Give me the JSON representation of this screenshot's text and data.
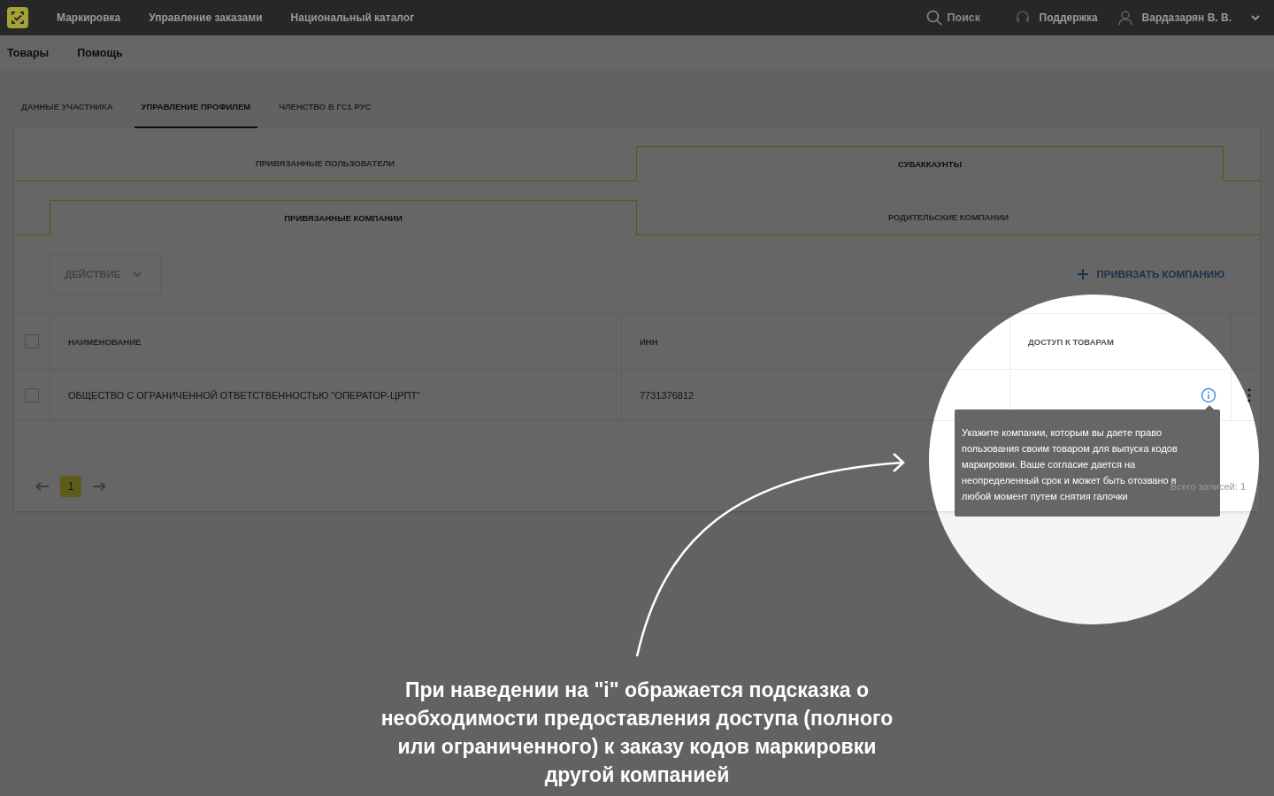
{
  "header": {
    "nav": [
      "Маркировка",
      "Управление заказами",
      "Национальный каталог"
    ],
    "search": {
      "placeholder": "Поиск"
    },
    "support": "Поддержка",
    "user": "Вардазарян В. В."
  },
  "subnav": [
    "Товары",
    "Помощь"
  ],
  "tabs": [
    {
      "label": "ДАННЫЕ УЧАСТНИКА",
      "selected": false
    },
    {
      "label": "УПРАВЛЕНИЕ ПРОФИЛЕМ",
      "selected": true
    },
    {
      "label": "ЧЛЕНСТВО В ГС1 РУС",
      "selected": false
    }
  ],
  "subtabs": [
    {
      "label": "ПРИВЯЗАННЫЕ ПОЛЬЗОВАТЕЛИ",
      "selected": false
    },
    {
      "label": "СУБАККАУНТЫ",
      "selected": true
    }
  ],
  "inner_tabs": [
    {
      "label": "ПРИВЯЗАННЫЕ КОМПАНИИ",
      "selected": true
    },
    {
      "label": "РОДИТЕЛЬСКИЕ КОМПАНИИ",
      "selected": false
    }
  ],
  "toolbar": {
    "action": "ДЕЙСТВИЕ",
    "add": "ПРИВЯЗАТЬ КОМПАНИЮ"
  },
  "table": {
    "all_checked": false,
    "columns": [
      "НАИМЕНОВАНИЕ",
      "ИНН",
      "ДОСТУП К ТОВАРАМ"
    ],
    "rows": [
      {
        "checked": false,
        "name": "ОБЩЕСТВО С ОГРАНИЧЕННОЙ ОТВЕТСТВЕННОСТЬЮ \"ОПЕРАТОР-ЦРПТ\"",
        "inn": "7731376812"
      }
    ]
  },
  "pagination": {
    "pages": [
      {
        "label": "1",
        "selected": true
      }
    ],
    "total": "Всего записей: 1"
  },
  "tooltip": "Укажите компании, которым вы даете право пользования своим товаром для выпуска кодов маркировки. Ваше согласие дается на неопределенный срок и может быть отозвано в любой момент путем снятия галочки",
  "annotation": "При наведении на \"i\" ображается подсказка о необходимости предоставления доступа (полного или ограниченного) к заказу кодов маркировки другой компанией"
}
